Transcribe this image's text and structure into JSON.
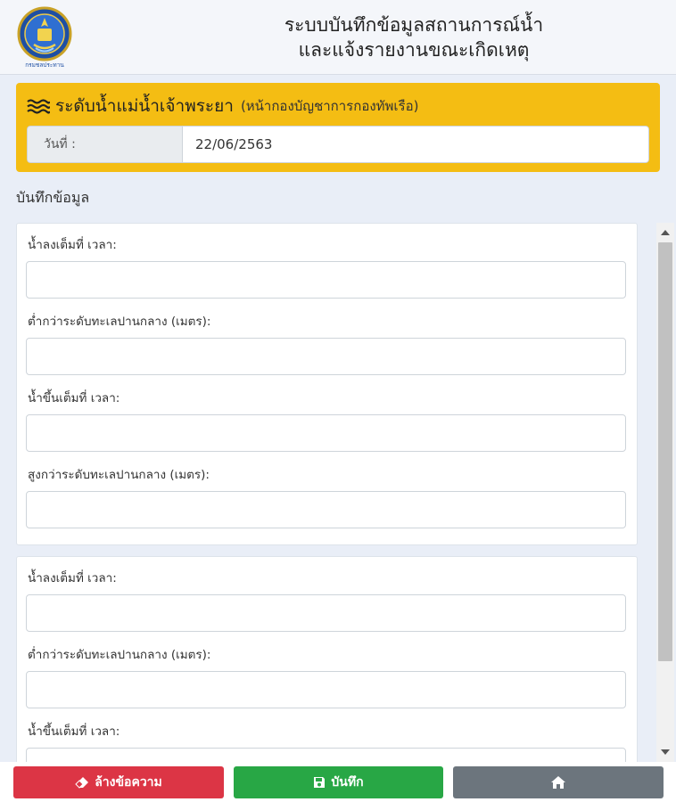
{
  "header": {
    "title_line1": "ระบบบันทึกข้อมูลสถานการณ์น้ำ",
    "title_line2": "และแจ้งรายงานขณะเกิดเหตุ",
    "logo_text": "กรมชลประทาน",
    "logo_icon": "royal-irrigation-department-seal"
  },
  "panel": {
    "icon": "water-waves-icon",
    "title": "ระดับน้ำแม่น้ำเจ้าพระยา",
    "subtitle": "(หน้ากองบัญชาการกองทัพเรือ)",
    "date_label": "วันที่ :",
    "date_value": "22/06/2563",
    "color": "#f4bd13"
  },
  "section_label": "บันทึกข้อมูล",
  "cards": [
    {
      "fields": [
        {
          "label": "น้ำลงเต็มที่ เวลา:",
          "value": ""
        },
        {
          "label": "ต่ำกว่าระดับทะเลปานกลาง (เมตร):",
          "value": ""
        },
        {
          "label": "น้ำขึ้นเต็มที่ เวลา:",
          "value": ""
        },
        {
          "label": "สูงกว่าระดับทะเลปานกลาง (เมตร):",
          "value": ""
        }
      ]
    },
    {
      "fields": [
        {
          "label": "น้ำลงเต็มที่ เวลา:",
          "value": ""
        },
        {
          "label": "ต่ำกว่าระดับทะเลปานกลาง (เมตร):",
          "value": ""
        },
        {
          "label": "น้ำขึ้นเต็มที่ เวลา:",
          "value": ""
        }
      ]
    }
  ],
  "footer": {
    "clear_label": "ล้างข้อความ",
    "clear_icon": "eraser-icon",
    "clear_color": "#dc3545",
    "save_label": "บันทึก",
    "save_icon": "floppy-disk-icon",
    "save_color": "#28a745",
    "home_icon": "home-icon",
    "home_color": "#6c757d"
  }
}
